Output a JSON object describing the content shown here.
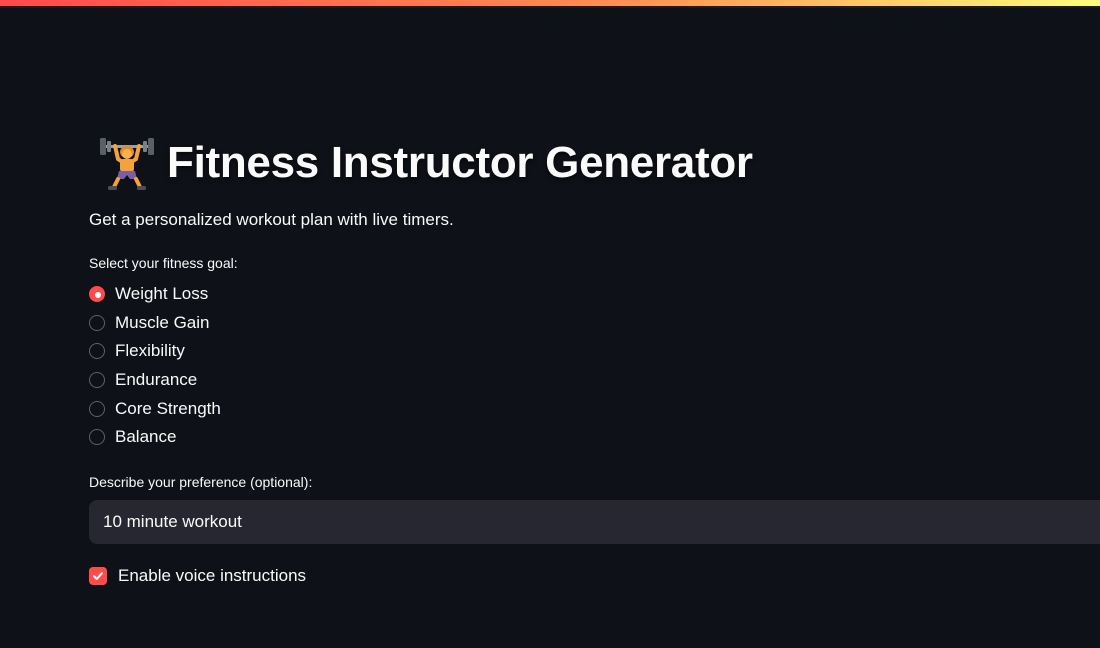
{
  "app": {
    "title": "Fitness Instructor Generator",
    "title_icon": "person-lifting-weights-icon",
    "subtitle": "Get a personalized workout plan with live timers."
  },
  "goal": {
    "label": "Select your fitness goal:",
    "selected": "Weight Loss",
    "options": [
      {
        "label": "Weight Loss",
        "selected": true
      },
      {
        "label": "Muscle Gain",
        "selected": false
      },
      {
        "label": "Flexibility",
        "selected": false
      },
      {
        "label": "Endurance",
        "selected": false
      },
      {
        "label": "Core Strength",
        "selected": false
      },
      {
        "label": "Balance",
        "selected": false
      }
    ]
  },
  "preference": {
    "label": "Describe your preference (optional):",
    "value": "10 minute workout"
  },
  "voice": {
    "label": "Enable voice instructions",
    "checked": true
  },
  "colors": {
    "accent": "#ff4b4b",
    "background": "#0e1117",
    "input_background": "#262730",
    "text": "#fafafa"
  }
}
